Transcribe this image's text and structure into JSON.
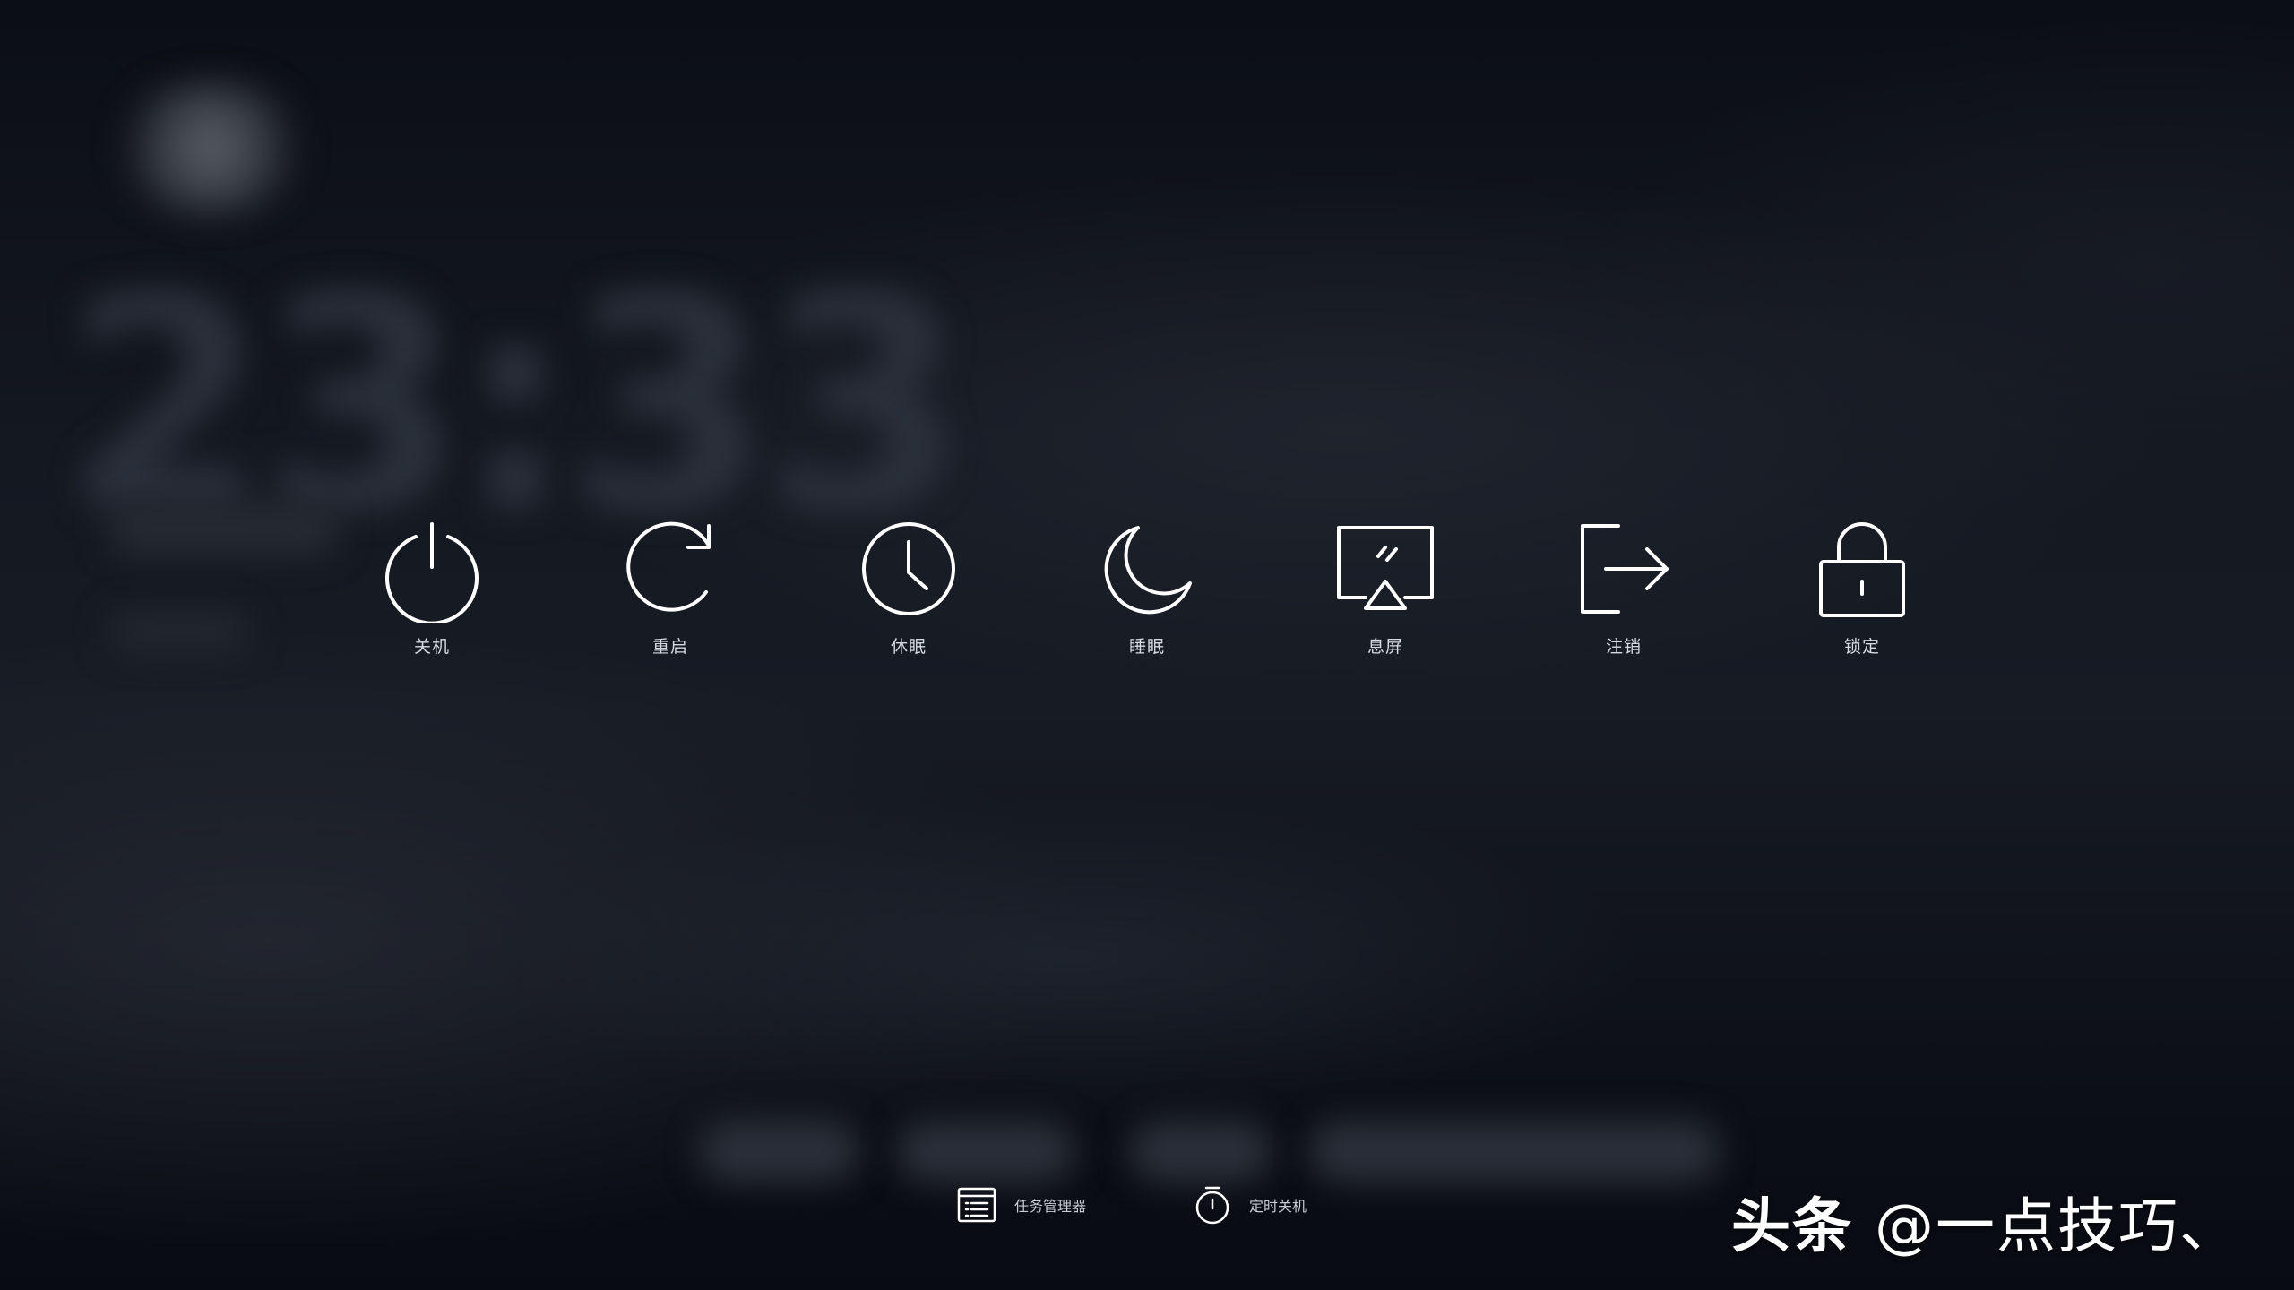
{
  "power_options": [
    {
      "id": "shutdown",
      "label": "关机",
      "icon": "power-icon"
    },
    {
      "id": "restart",
      "label": "重启",
      "icon": "restart-icon"
    },
    {
      "id": "hibernate",
      "label": "休眠",
      "icon": "clock-icon"
    },
    {
      "id": "sleep",
      "label": "睡眠",
      "icon": "moon-icon"
    },
    {
      "id": "screen-off",
      "label": "息屏",
      "icon": "monitor-icon"
    },
    {
      "id": "logout",
      "label": "注销",
      "icon": "logout-icon"
    },
    {
      "id": "lock",
      "label": "锁定",
      "icon": "lock-icon"
    }
  ],
  "tools": {
    "task_manager": {
      "label": "任务管理器",
      "icon": "task-list-icon"
    },
    "timed_shutdown": {
      "label": "定时关机",
      "icon": "stopwatch-icon"
    }
  },
  "watermark": {
    "brand": "头条",
    "handle": "@一点技巧、"
  },
  "colors": {
    "icon_stroke": "#ffffff",
    "label_text": "#d8dbe2",
    "background": "#0c0f17"
  }
}
